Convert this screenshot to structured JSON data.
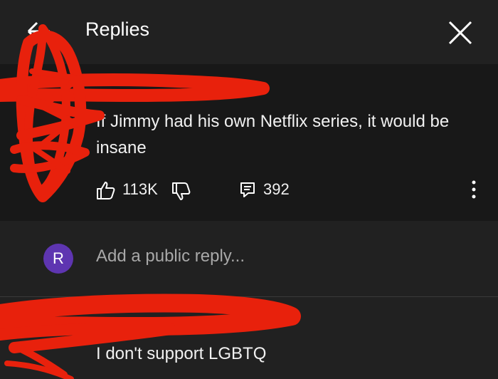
{
  "header": {
    "title": "Replies"
  },
  "parent_comment": {
    "text": "If Jimmy had his own Netflix series, it would be insane",
    "like_count": "113K",
    "reply_count": "392"
  },
  "reply_box": {
    "avatar_letter": "R",
    "placeholder": "Add a public reply...",
    "avatar_color": "#5e35b1"
  },
  "reply": {
    "text": "I don't support LGBTQ"
  },
  "colors": {
    "background": "#212121",
    "comment_bg": "#181818",
    "redaction": "#e8210c"
  }
}
